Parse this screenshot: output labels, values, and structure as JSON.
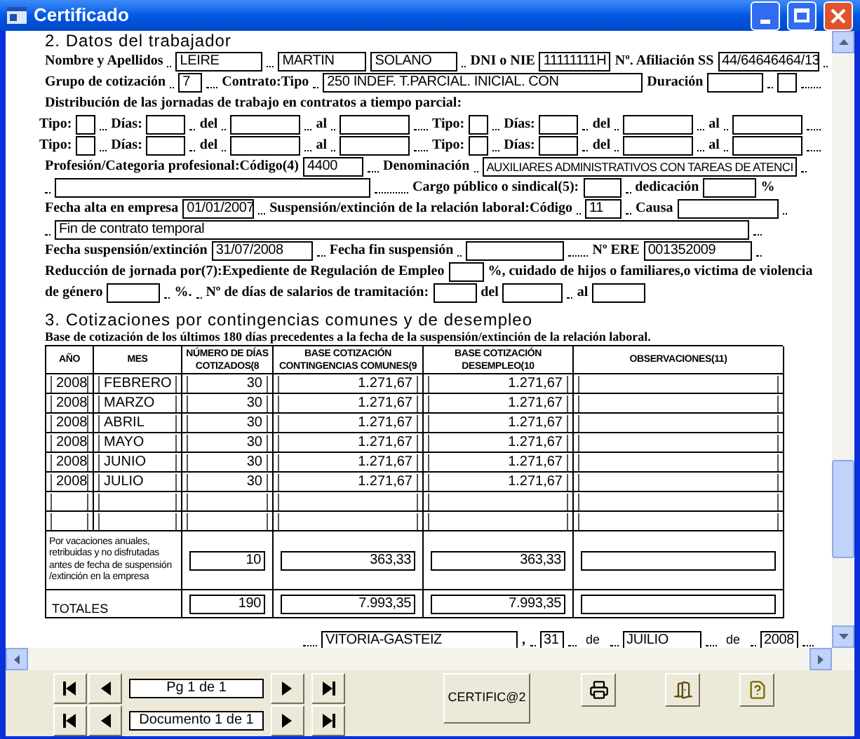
{
  "window": {
    "title": "Certificado"
  },
  "worker": {
    "heading": "2. Datos del trabajador",
    "name_label": "Nombre y Apellidos",
    "first_name": "LEIRE",
    "surname_1": "MARTIN",
    "surname_2": "SOLANO",
    "dni_label": "DNI o NIE",
    "dni": "11111111H",
    "ss_label": "Nº. Afiliación SS",
    "ss": "44/64646464/13",
    "group_label": "Grupo de cotización",
    "group": "7",
    "contract_label": "Contrato:Tipo",
    "contract": "250 INDEF. T.PARCIAL. INICIAL. CON",
    "duration_label": "Duración",
    "distribution_label": "Distribución de las jornadas de trabajo en contratos a tiempo parcial:",
    "part_time_rows": [
      {
        "groups": [
          {
            "type_label": "Tipo:",
            "days_label": "Días:",
            "from_label": "del",
            "to_label": "al"
          },
          {
            "type_label": "Tipo:",
            "days_label": "Días:",
            "from_label": "del",
            "to_label": "al"
          }
        ]
      },
      {
        "groups": [
          {
            "type_label": "Tipo:",
            "days_label": "Días:",
            "from_label": "del",
            "to_label": "al"
          },
          {
            "type_label": "Tipo:",
            "days_label": "Días:",
            "from_label": "del",
            "to_label": "al"
          }
        ]
      }
    ],
    "profession_label": "Profesión/Categoria profesional:Código(4)",
    "profession_code": "4400",
    "denomination_label": "Denominación",
    "denomination": "AUXILIARES ADMINISTRATIVOS CON TAREAS DE ATENCI",
    "cargo_label": "Cargo público o sindical(5):",
    "dedication_label": "dedicación",
    "dedication_unit": "%",
    "start_label": "Fecha alta en empresa",
    "start_date": "01/01/2007",
    "suspension_label": "Suspensión/extinción de la relación laboral:Código",
    "suspension_code": "11",
    "cause_label": "Causa",
    "cause_text": "Fin de contrato temporal",
    "suspension_date_label": "Fecha suspensión/extinción",
    "suspension_date": "31/07/2008",
    "end_suspension_label": "Fecha fin suspensión",
    "ere_label": "Nº ERE",
    "ere": "001352009",
    "reduction_label": "Reducción de jornada por(7):Expediente de Regulación de Empleo",
    "reduction_suffix": "%, cuidado de hijos o familiares,o victima de violencia",
    "gender_label": "de género",
    "gender_suffix": "%.",
    "wage_days_label": "Nº de días de salarios de tramitación:",
    "wage_from_label": "del",
    "wage_to_label": "al"
  },
  "contributions": {
    "heading": "3. Cotizaciones por contingencias comunes y de desempleo",
    "subtitle": "Base de cotización de los últimos 180 días precedentes a la fecha de la suspensión/extinción de la relación laboral.",
    "columns": [
      {
        "lines": [
          "AÑO"
        ]
      },
      {
        "lines": [
          "MES"
        ]
      },
      {
        "lines": [
          "NÚMERO DE DÍAS",
          "COTIZADOS(8"
        ]
      },
      {
        "lines": [
          "BASE COTIZACIÓN",
          "CONTINGENCIAS COMUNES(9"
        ]
      },
      {
        "lines": [
          "BASE COTIZACIÓN",
          "DESEMPLEO(10"
        ]
      },
      {
        "lines": [
          "OBSERVACIONES(11)"
        ]
      }
    ],
    "rows": [
      {
        "year": "2008",
        "month": "FEBRERO",
        "days": "30",
        "base_common": "1.271,67",
        "base_unemployment": "1.271,67"
      },
      {
        "year": "2008",
        "month": "MARZO",
        "days": "30",
        "base_common": "1.271,67",
        "base_unemployment": "1.271,67"
      },
      {
        "year": "2008",
        "month": "ABRIL",
        "days": "30",
        "base_common": "1.271,67",
        "base_unemployment": "1.271,67"
      },
      {
        "year": "2008",
        "month": "MAYO",
        "days": "30",
        "base_common": "1.271,67",
        "base_unemployment": "1.271,67"
      },
      {
        "year": "2008",
        "month": "JUNIO",
        "days": "30",
        "base_common": "1.271,67",
        "base_unemployment": "1.271,67"
      },
      {
        "year": "2008",
        "month": "JULIO",
        "days": "30",
        "base_common": "1.271,67",
        "base_unemployment": "1.271,67"
      }
    ],
    "vacation": {
      "label": "Por vacaciones anuales, retribuidas y no disfrutadas antes de fecha de suspensión /extinción en la empresa",
      "days": "10",
      "base_common": "363,33",
      "base_unemployment": "363,33"
    },
    "totals": {
      "label": "TOTALES",
      "days": "190",
      "base_common": "7.993,35",
      "base_unemployment": "7.993,35"
    }
  },
  "signature": {
    "place": "VITORIA-GASTEIZ",
    "comma": ",",
    "day": "31",
    "de_1": "de",
    "month": "JUILIO",
    "de_2": "de",
    "year": "2008"
  },
  "toolbar": {
    "pagers": [
      {
        "label": "Pg 1 de 1"
      },
      {
        "label": "Documento 1 de 1"
      }
    ],
    "main_button": "CERTIFIC@2"
  }
}
